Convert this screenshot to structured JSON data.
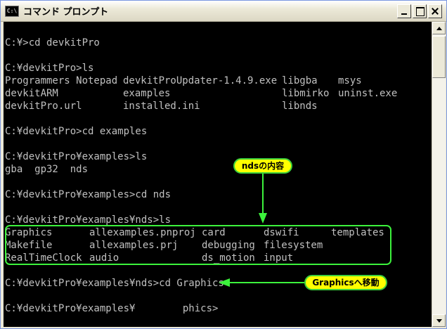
{
  "window": {
    "title": "コマンド プロンプト",
    "icon_label": "C:\\"
  },
  "console": {
    "lines": [
      "",
      "C:¥>cd devkitPro",
      "",
      "C:¥devkitPro>ls",
      "",
      "",
      "",
      "",
      "C:¥devkitPro>cd examples",
      "",
      "C:¥devkitPro¥examples>ls",
      "gba  gp32  nds",
      "",
      "C:¥devkitPro¥examples>cd nds",
      "",
      "C:¥devkitPro¥examples¥nds>ls",
      "",
      "",
      "",
      "",
      "C:¥devkitPro¥examples¥nds>cd Graphics",
      "",
      "C:¥devkitPro¥examples¥        phics>"
    ],
    "root_listing": [
      [
        "Programmers Notepad",
        "devkitProUpdater-1.4.9.exe",
        "libgba",
        "msys"
      ],
      [
        "devkitARM",
        "examples",
        "libmirko",
        "uninst.exe"
      ],
      [
        "devkitPro.url",
        "installed.ini",
        "libnds",
        ""
      ]
    ],
    "nds_listing": [
      [
        "Graphics",
        "allexamples.pnproj",
        "card",
        "dswifi",
        "templates"
      ],
      [
        "Makefile",
        "allexamples.prj",
        "debugging",
        "filesystem",
        ""
      ],
      [
        "RealTimeClock",
        "audio",
        "ds_motion",
        "input",
        ""
      ]
    ]
  },
  "annotations": {
    "nds_contents": "ndsの内容",
    "move_to_graphics": "Graphicsへ移動"
  },
  "colors": {
    "console_bg": "#000000",
    "console_text": "#c0c0c0",
    "callout_fill": "#ffff00",
    "callout_border": "#3cf23c"
  }
}
